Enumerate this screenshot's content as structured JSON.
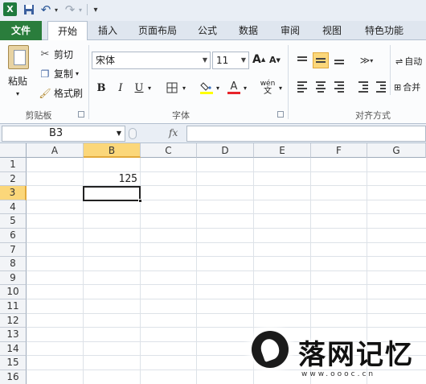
{
  "qat": {
    "logo": "X",
    "undo": "↶",
    "redo": "↷",
    "customize": "▾"
  },
  "tabs": [
    "文件",
    "开始",
    "插入",
    "页面布局",
    "公式",
    "数据",
    "审阅",
    "视图",
    "特色功能"
  ],
  "clipboard": {
    "paste": "粘贴",
    "cut": "剪切",
    "copy": "复制",
    "format_painter": "格式刷",
    "group_label": "剪贴板"
  },
  "font": {
    "name": "宋体",
    "size": "11",
    "group_label": "字体",
    "bold": "B",
    "italic": "I",
    "underline": "U",
    "grow": "A",
    "shrink": "A",
    "font_color_letter": "A",
    "phonetic": "wén"
  },
  "alignment": {
    "group_label": "对齐方式",
    "wrap": "自动",
    "merge": "合并"
  },
  "formula_bar": {
    "name_box": "B3",
    "fx": "fx",
    "formula": ""
  },
  "grid": {
    "columns": [
      "A",
      "B",
      "C",
      "D",
      "E",
      "F",
      "G"
    ],
    "rows": [
      "1",
      "2",
      "3",
      "4",
      "5",
      "6",
      "7",
      "8",
      "9",
      "10",
      "11",
      "12",
      "13",
      "14",
      "15",
      "16"
    ],
    "selected_column": "B",
    "selected_row": "3",
    "cells": {
      "B2": "125"
    }
  },
  "watermark": {
    "text": "落网记忆",
    "url": "www.oooc.cn"
  },
  "colors": {
    "file_tab": "#2a7d3c",
    "selection_highlight": "#fbd77a",
    "font_color_bar": "#e8242b",
    "fill_color_bar": "#ffff00"
  }
}
